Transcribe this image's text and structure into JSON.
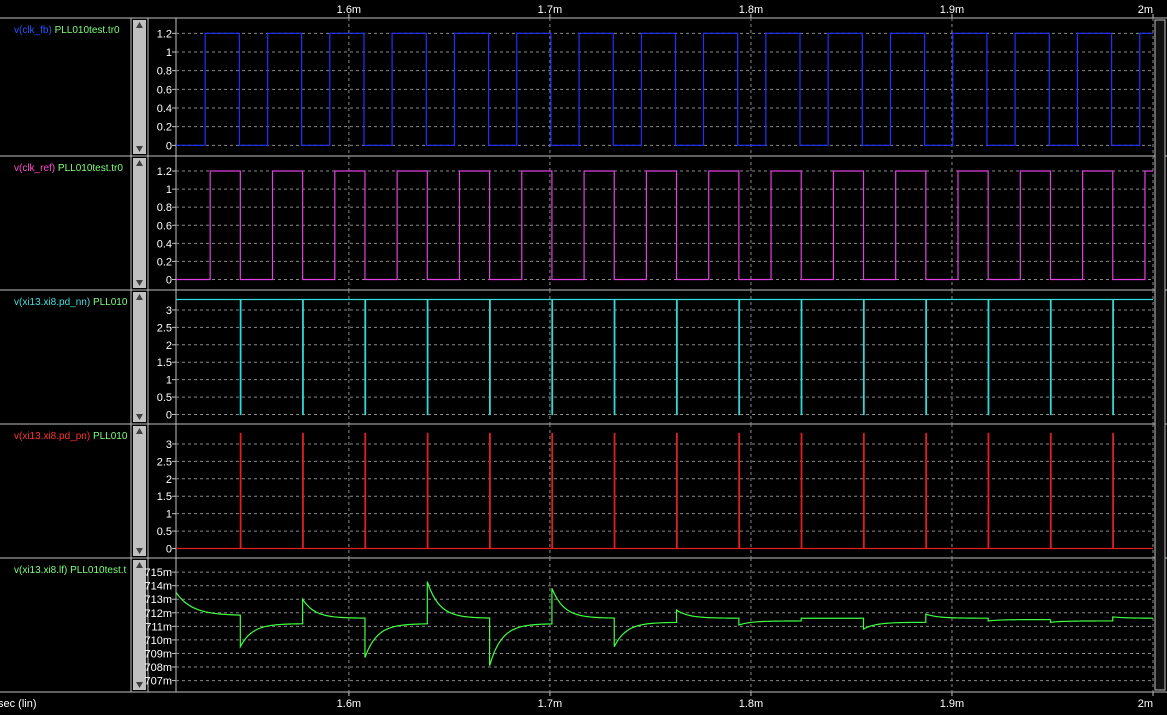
{
  "window": {
    "background_color": "#000000",
    "grid_color": "#8a8a8a",
    "border_color": "#c0c0c0",
    "tick_text_color": "#ffffff",
    "scrollbar_color": "#c0c0c0"
  },
  "chart_data": {
    "type": "line",
    "x_axis": {
      "range": [
        1.514,
        2.0
      ],
      "unit_scale": "m",
      "ticks": [
        1.6,
        1.7,
        1.8,
        1.9,
        2.0
      ],
      "tick_labels": [
        "1.6m",
        "1.7m",
        "1.8m",
        "1.9m",
        "2m"
      ],
      "label": "sec (lin)",
      "grid": true
    },
    "panels": [
      {
        "name": "clk_fb",
        "label_prefix": "v(clk_fb)",
        "label_source": "PLL010test.tr0",
        "label_prefix_color": "#1e58ff",
        "label_source_color": "#7cff7c",
        "trace_color": "#2030ff",
        "ylim": [
          -0.05,
          1.3
        ],
        "yticks": [
          0,
          0.2,
          0.4,
          0.6,
          0.8,
          1,
          1.2
        ],
        "ytick_labels": [
          "0",
          "0.2",
          "0.4",
          "0.6",
          "0.8",
          "1",
          "1.2"
        ],
        "low": 0,
        "high": 1.2,
        "rises": [
          1.5285,
          1.5596,
          1.5905,
          1.6215,
          1.6525,
          1.6835,
          1.7145,
          1.7455,
          1.7764,
          1.8074,
          1.8384,
          1.8694,
          1.9004,
          1.9314,
          1.9624,
          1.9934
        ],
        "falls": [
          1.5455,
          1.5765,
          1.6075,
          1.6385,
          1.6695,
          1.7005,
          1.7315,
          1.7625,
          1.7934,
          1.8244,
          1.8554,
          1.8864,
          1.9174,
          1.9484,
          1.9794
        ]
      },
      {
        "name": "clk_ref",
        "label_prefix": "v(clk_ref)",
        "label_source": "PLL010test.tr0",
        "label_prefix_color": "#ff4dd2",
        "label_source_color": "#7cff7c",
        "trace_color": "#e040e0",
        "ylim": [
          -0.05,
          1.3
        ],
        "yticks": [
          0,
          0.2,
          0.4,
          0.6,
          0.8,
          1,
          1.2
        ],
        "ytick_labels": [
          "0",
          "0.2",
          "0.4",
          "0.6",
          "0.8",
          "1",
          "1.2"
        ],
        "low": 0,
        "high": 1.2,
        "rises": [
          1.531,
          1.562,
          1.593,
          1.624,
          1.655,
          1.686,
          1.717,
          1.748,
          1.779,
          1.81,
          1.841,
          1.872,
          1.903,
          1.934,
          1.965,
          1.996
        ],
        "falls": [
          1.546,
          1.577,
          1.608,
          1.639,
          1.67,
          1.701,
          1.732,
          1.763,
          1.794,
          1.825,
          1.856,
          1.887,
          1.918,
          1.949,
          1.98
        ]
      },
      {
        "name": "pd_nn",
        "label_prefix": "v(xi13.xi8.pd_nn)",
        "label_source": "PLL010",
        "label_prefix_color": "#40e0e0",
        "label_source_color": "#7cff7c",
        "trace_color": "#30d8d8",
        "ylim": [
          -0.1,
          3.4
        ],
        "yticks": [
          0,
          0.5,
          1,
          1.5,
          2,
          2.5,
          3
        ],
        "ytick_labels": [
          "0",
          "0.5",
          "1",
          "1.5",
          "2",
          "2.5",
          "3"
        ],
        "baseline": 3.3,
        "pulse_to": 0,
        "pulses": [
          1.546,
          1.577,
          1.608,
          1.639,
          1.67,
          1.701,
          1.732,
          1.763,
          1.794,
          1.825,
          1.856,
          1.887,
          1.918,
          1.949,
          1.98
        ]
      },
      {
        "name": "pd_pn",
        "label_prefix": "v(xi13.xi8.pd_pn)",
        "label_source": "PLL010",
        "label_prefix_color": "#ff3030",
        "label_source_color": "#7cff7c",
        "trace_color": "#e02020",
        "ylim": [
          -0.1,
          3.4
        ],
        "yticks": [
          0,
          0.5,
          1,
          1.5,
          2,
          2.5,
          3
        ],
        "ytick_labels": [
          "0",
          "0.5",
          "1",
          "1.5",
          "2",
          "2.5",
          "3"
        ],
        "baseline": 0,
        "pulse_to": 3.3,
        "pulses": [
          1.546,
          1.577,
          1.608,
          1.639,
          1.67,
          1.701,
          1.732,
          1.763,
          1.794,
          1.825,
          1.856,
          1.887,
          1.918,
          1.949,
          1.98
        ]
      },
      {
        "name": "lf",
        "label_prefix": "v(xi13.xi8.lf)",
        "label_source": "PLL010test.t",
        "label_prefix_color": "#7cff7c",
        "label_source_color": "#7cff7c",
        "trace_color": "#40ff40",
        "ylim": [
          706.6,
          715.6
        ],
        "yticks": [
          707,
          708,
          709,
          710,
          711,
          712,
          713,
          714,
          715
        ],
        "ytick_labels": [
          "707m",
          "708m",
          "709m",
          "710m",
          "711m",
          "712m",
          "713m",
          "714m",
          "715m"
        ],
        "start_value": 713.5,
        "segments": [
          {
            "t": 1.546,
            "from": 711.8,
            "to": 709.5,
            "settle": 711.2
          },
          {
            "t": 1.577,
            "from": 711.2,
            "to": 713.0,
            "settle": 711.6
          },
          {
            "t": 1.608,
            "from": 711.6,
            "to": 708.7,
            "settle": 711.2
          },
          {
            "t": 1.639,
            "from": 711.2,
            "to": 714.3,
            "settle": 711.6
          },
          {
            "t": 1.67,
            "from": 711.6,
            "to": 708.1,
            "settle": 711.2
          },
          {
            "t": 1.701,
            "from": 711.2,
            "to": 713.8,
            "settle": 711.6
          },
          {
            "t": 1.732,
            "from": 711.6,
            "to": 709.5,
            "settle": 711.3
          },
          {
            "t": 1.763,
            "from": 711.3,
            "to": 712.2,
            "settle": 711.6
          },
          {
            "t": 1.794,
            "from": 711.6,
            "to": 711.1,
            "settle": 711.4
          },
          {
            "t": 1.825,
            "from": 711.4,
            "to": 711.6,
            "settle": 711.6
          },
          {
            "t": 1.856,
            "from": 711.6,
            "to": 710.8,
            "settle": 711.3
          },
          {
            "t": 1.887,
            "from": 711.3,
            "to": 711.9,
            "settle": 711.6
          },
          {
            "t": 1.918,
            "from": 711.6,
            "to": 711.4,
            "settle": 711.5
          },
          {
            "t": 1.949,
            "from": 711.5,
            "to": 711.3,
            "settle": 711.4
          },
          {
            "t": 1.98,
            "from": 711.4,
            "to": 711.7,
            "settle": 711.6
          }
        ]
      }
    ]
  }
}
